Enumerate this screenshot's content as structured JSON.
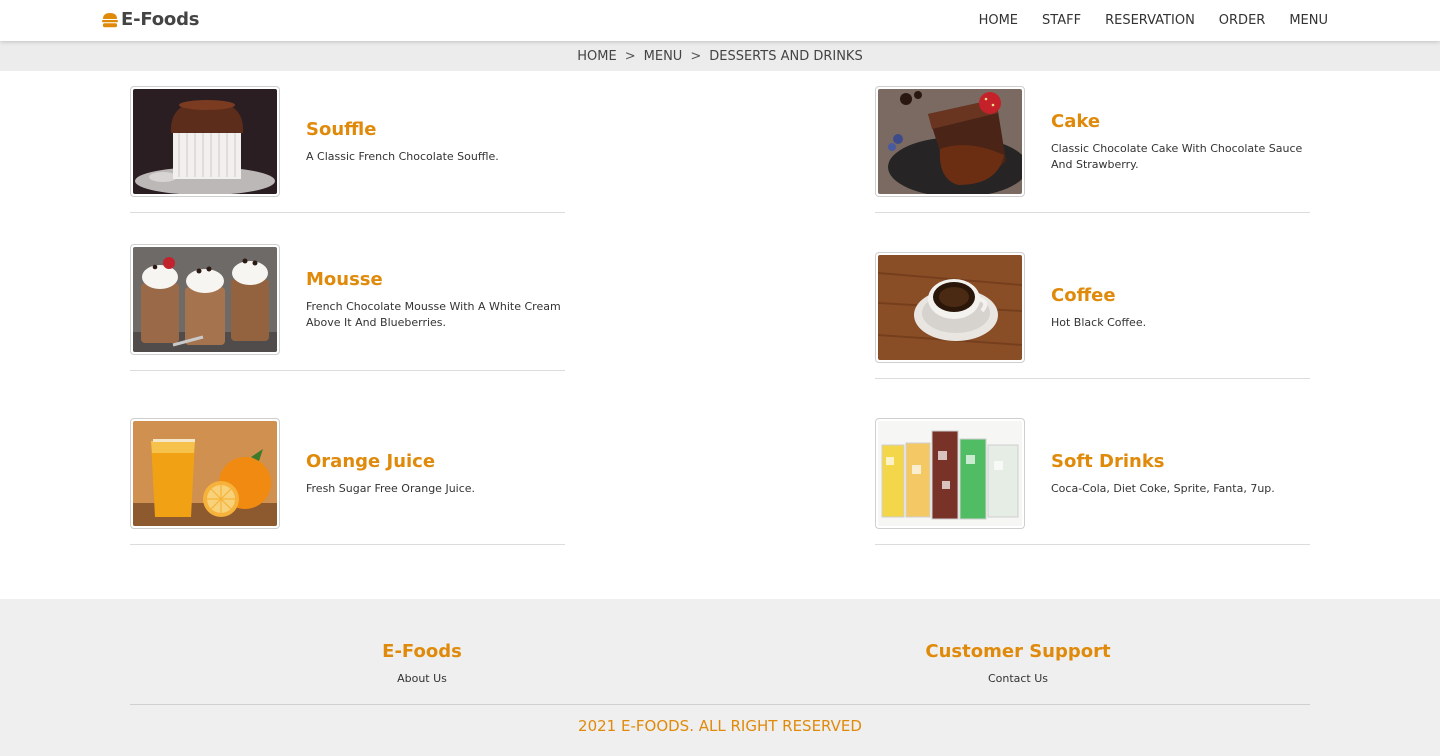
{
  "brand": {
    "name": "E-Foods",
    "icon": "burger-icon",
    "accent": "#e08a0b"
  },
  "nav": {
    "items": [
      {
        "label": "HOME"
      },
      {
        "label": "STAFF"
      },
      {
        "label": "RESERVATION"
      },
      {
        "label": "ORDER"
      },
      {
        "label": "MENU"
      }
    ]
  },
  "breadcrumb": [
    {
      "label": "HOME"
    },
    {
      "label": "MENU"
    },
    {
      "label": "DESSERTS AND DRINKS"
    }
  ],
  "breadcrumb_separator": ">",
  "menu_items": [
    {
      "title": "Souffle",
      "desc": "A Classic French Chocolate Souffle.",
      "image": "souffle-image"
    },
    {
      "title": "Cake",
      "desc": "Classic Chocolate Cake With Chocolate Sauce And Strawberry.",
      "image": "cake-image"
    },
    {
      "title": "Mousse",
      "desc": "French Chocolate Mousse With A White Cream Above It And Blueberries.",
      "image": "mousse-image"
    },
    {
      "title": "Coffee",
      "desc": "Hot Black Coffee.",
      "image": "coffee-image"
    },
    {
      "title": "Orange Juice",
      "desc": "Fresh Sugar Free Orange Juice.",
      "image": "orange-juice-image"
    },
    {
      "title": "Soft Drinks",
      "desc": "Coca-Cola, Diet Coke, Sprite, Fanta, 7up.",
      "image": "soft-drinks-image"
    }
  ],
  "footer": {
    "columns": [
      {
        "title": "E-Foods",
        "link": "About Us"
      },
      {
        "title": "Customer Support",
        "link": "Contact Us"
      }
    ],
    "copyright": "2021 E-FOODS. ALL RIGHT RESERVED"
  }
}
